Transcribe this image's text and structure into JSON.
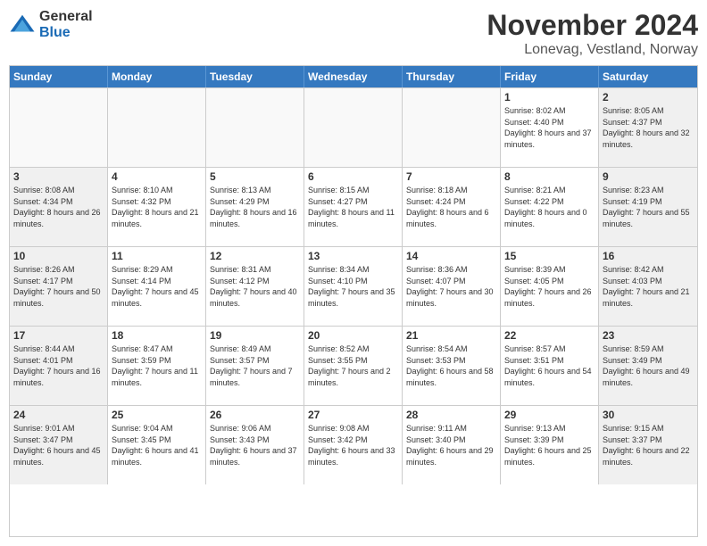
{
  "logo": {
    "general": "General",
    "blue": "Blue"
  },
  "title": "November 2024",
  "location": "Lonevag, Vestland, Norway",
  "header_days": [
    "Sunday",
    "Monday",
    "Tuesday",
    "Wednesday",
    "Thursday",
    "Friday",
    "Saturday"
  ],
  "weeks": [
    [
      {
        "day": "",
        "info": "",
        "empty": true
      },
      {
        "day": "",
        "info": "",
        "empty": true
      },
      {
        "day": "",
        "info": "",
        "empty": true
      },
      {
        "day": "",
        "info": "",
        "empty": true
      },
      {
        "day": "",
        "info": "",
        "empty": true
      },
      {
        "day": "1",
        "info": "Sunrise: 8:02 AM\nSunset: 4:40 PM\nDaylight: 8 hours and 37 minutes."
      },
      {
        "day": "2",
        "info": "Sunrise: 8:05 AM\nSunset: 4:37 PM\nDaylight: 8 hours and 32 minutes."
      }
    ],
    [
      {
        "day": "3",
        "info": "Sunrise: 8:08 AM\nSunset: 4:34 PM\nDaylight: 8 hours and 26 minutes."
      },
      {
        "day": "4",
        "info": "Sunrise: 8:10 AM\nSunset: 4:32 PM\nDaylight: 8 hours and 21 minutes."
      },
      {
        "day": "5",
        "info": "Sunrise: 8:13 AM\nSunset: 4:29 PM\nDaylight: 8 hours and 16 minutes."
      },
      {
        "day": "6",
        "info": "Sunrise: 8:15 AM\nSunset: 4:27 PM\nDaylight: 8 hours and 11 minutes."
      },
      {
        "day": "7",
        "info": "Sunrise: 8:18 AM\nSunset: 4:24 PM\nDaylight: 8 hours and 6 minutes."
      },
      {
        "day": "8",
        "info": "Sunrise: 8:21 AM\nSunset: 4:22 PM\nDaylight: 8 hours and 0 minutes."
      },
      {
        "day": "9",
        "info": "Sunrise: 8:23 AM\nSunset: 4:19 PM\nDaylight: 7 hours and 55 minutes."
      }
    ],
    [
      {
        "day": "10",
        "info": "Sunrise: 8:26 AM\nSunset: 4:17 PM\nDaylight: 7 hours and 50 minutes."
      },
      {
        "day": "11",
        "info": "Sunrise: 8:29 AM\nSunset: 4:14 PM\nDaylight: 7 hours and 45 minutes."
      },
      {
        "day": "12",
        "info": "Sunrise: 8:31 AM\nSunset: 4:12 PM\nDaylight: 7 hours and 40 minutes."
      },
      {
        "day": "13",
        "info": "Sunrise: 8:34 AM\nSunset: 4:10 PM\nDaylight: 7 hours and 35 minutes."
      },
      {
        "day": "14",
        "info": "Sunrise: 8:36 AM\nSunset: 4:07 PM\nDaylight: 7 hours and 30 minutes."
      },
      {
        "day": "15",
        "info": "Sunrise: 8:39 AM\nSunset: 4:05 PM\nDaylight: 7 hours and 26 minutes."
      },
      {
        "day": "16",
        "info": "Sunrise: 8:42 AM\nSunset: 4:03 PM\nDaylight: 7 hours and 21 minutes."
      }
    ],
    [
      {
        "day": "17",
        "info": "Sunrise: 8:44 AM\nSunset: 4:01 PM\nDaylight: 7 hours and 16 minutes."
      },
      {
        "day": "18",
        "info": "Sunrise: 8:47 AM\nSunset: 3:59 PM\nDaylight: 7 hours and 11 minutes."
      },
      {
        "day": "19",
        "info": "Sunrise: 8:49 AM\nSunset: 3:57 PM\nDaylight: 7 hours and 7 minutes."
      },
      {
        "day": "20",
        "info": "Sunrise: 8:52 AM\nSunset: 3:55 PM\nDaylight: 7 hours and 2 minutes."
      },
      {
        "day": "21",
        "info": "Sunrise: 8:54 AM\nSunset: 3:53 PM\nDaylight: 6 hours and 58 minutes."
      },
      {
        "day": "22",
        "info": "Sunrise: 8:57 AM\nSunset: 3:51 PM\nDaylight: 6 hours and 54 minutes."
      },
      {
        "day": "23",
        "info": "Sunrise: 8:59 AM\nSunset: 3:49 PM\nDaylight: 6 hours and 49 minutes."
      }
    ],
    [
      {
        "day": "24",
        "info": "Sunrise: 9:01 AM\nSunset: 3:47 PM\nDaylight: 6 hours and 45 minutes."
      },
      {
        "day": "25",
        "info": "Sunrise: 9:04 AM\nSunset: 3:45 PM\nDaylight: 6 hours and 41 minutes."
      },
      {
        "day": "26",
        "info": "Sunrise: 9:06 AM\nSunset: 3:43 PM\nDaylight: 6 hours and 37 minutes."
      },
      {
        "day": "27",
        "info": "Sunrise: 9:08 AM\nSunset: 3:42 PM\nDaylight: 6 hours and 33 minutes."
      },
      {
        "day": "28",
        "info": "Sunrise: 9:11 AM\nSunset: 3:40 PM\nDaylight: 6 hours and 29 minutes."
      },
      {
        "day": "29",
        "info": "Sunrise: 9:13 AM\nSunset: 3:39 PM\nDaylight: 6 hours and 25 minutes."
      },
      {
        "day": "30",
        "info": "Sunrise: 9:15 AM\nSunset: 3:37 PM\nDaylight: 6 hours and 22 minutes."
      }
    ]
  ]
}
